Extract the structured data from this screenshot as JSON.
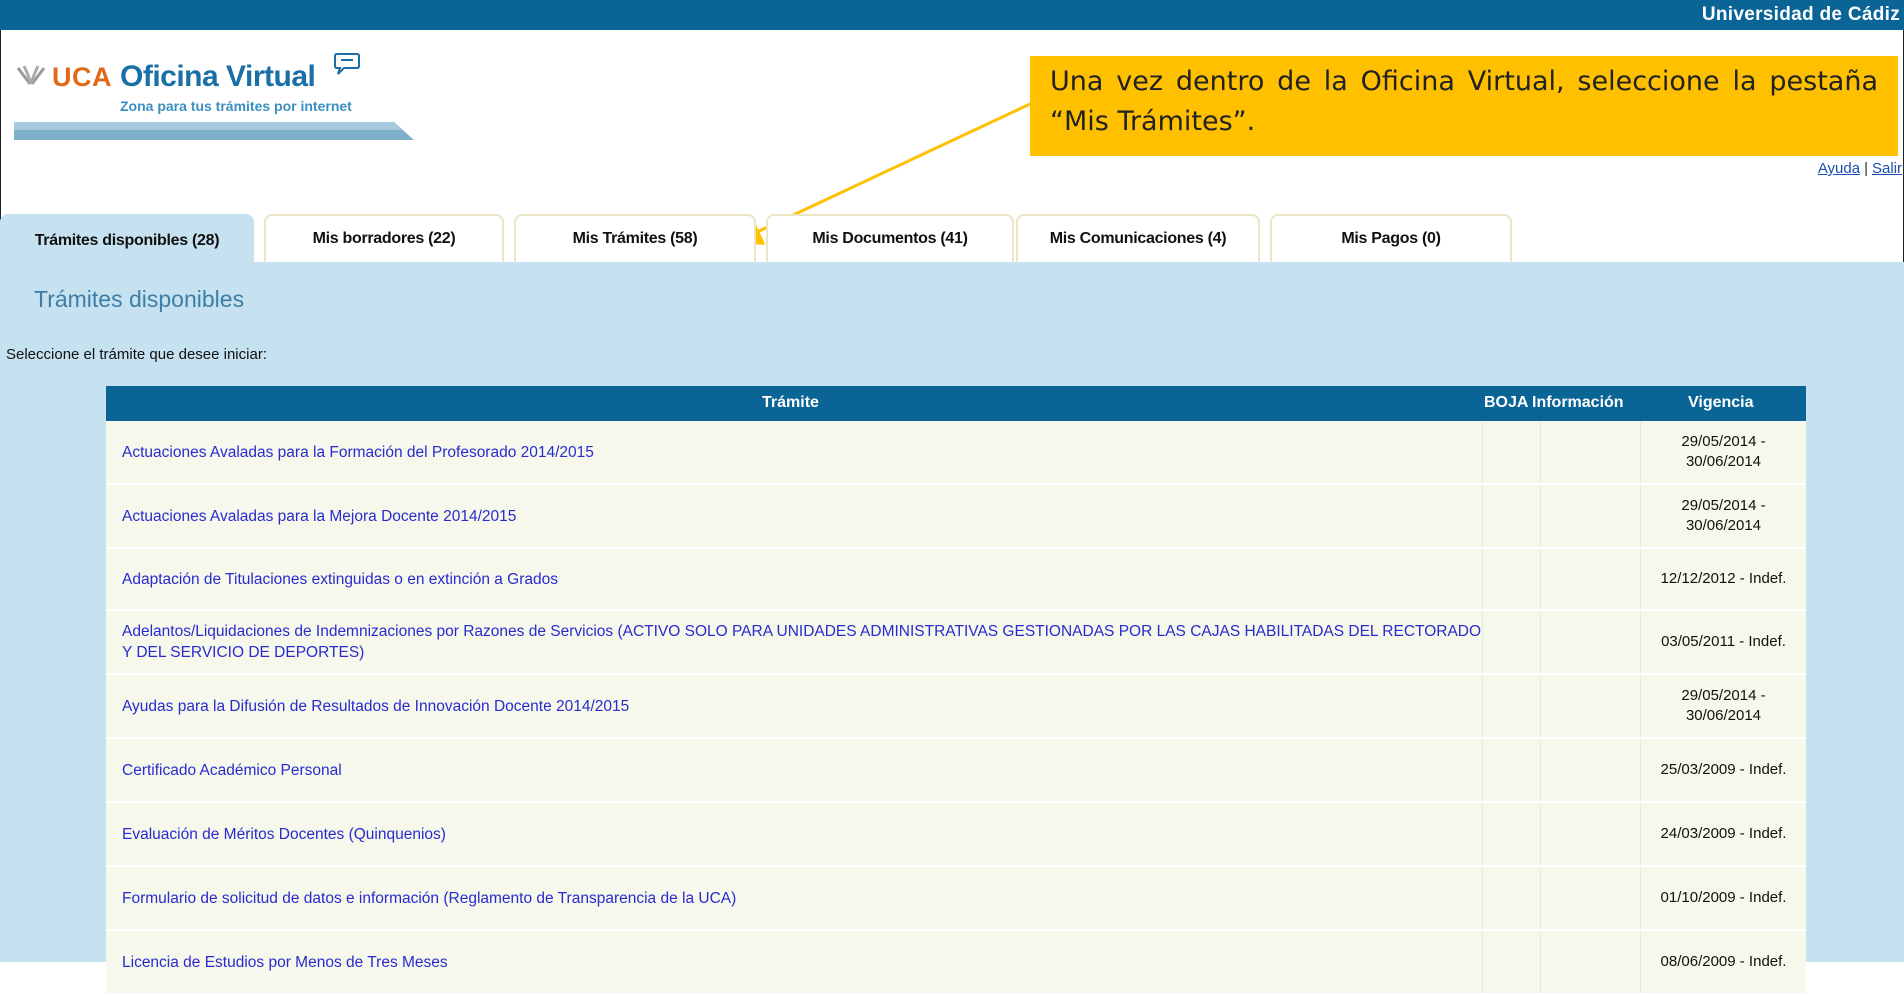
{
  "header": {
    "university": "Universidad de Cádiz",
    "logo": {
      "brand": "UCA",
      "title": "Oficina Virtual",
      "subtitle": "Zona para tus trámites por internet"
    },
    "links": {
      "help": "Ayuda",
      "separator": "|",
      "logout": "Salir"
    }
  },
  "callout": {
    "text": "Una vez dentro de la Oficina Virtual, seleccione la pestaña “Mis Trámites”."
  },
  "tabs": [
    {
      "label": "Trámites disponibles (28)",
      "active": true
    },
    {
      "label": "Mis borradores (22)",
      "active": false
    },
    {
      "label": "Mis Trámites (58)",
      "active": false
    },
    {
      "label": "Mis Documentos (41)",
      "active": false
    },
    {
      "label": "Mis Comunicaciones (4)",
      "active": false
    },
    {
      "label": "Mis Pagos (0)",
      "active": false
    }
  ],
  "main": {
    "title": "Trámites disponibles",
    "instructions": "Seleccione el trámite que desee iniciar:",
    "table": {
      "headers": {
        "tramite": "Trámite",
        "boja": "BOJA",
        "info": "Información",
        "vigencia": "Vigencia"
      },
      "rows": [
        {
          "name": "Actuaciones Avaladas para la Formación del Profesorado 2014/2015",
          "vigencia": "29/05/2014 - 30/06/2014"
        },
        {
          "name": "Actuaciones Avaladas para la Mejora Docente 2014/2015",
          "vigencia": "29/05/2014 - 30/06/2014"
        },
        {
          "name": "Adaptación de Titulaciones extinguidas o en extinción a Grados",
          "vigencia": "12/12/2012 - Indef."
        },
        {
          "name": "Adelantos/Liquidaciones de Indemnizaciones por Razones de Servicios (ACTIVO SOLO PARA UNIDADES ADMINISTRATIVAS GESTIONADAS POR LAS CAJAS HABILITADAS DEL RECTORADO Y DEL SERVICIO DE DEPORTES)",
          "vigencia": "03/05/2011 - Indef."
        },
        {
          "name": "Ayudas para la Difusión de Resultados de Innovación Docente 2014/2015",
          "vigencia": "29/05/2014 - 30/06/2014"
        },
        {
          "name": "Certificado Académico Personal",
          "vigencia": "25/03/2009 - Indef."
        },
        {
          "name": "Evaluación de Méritos Docentes (Quinquenios)",
          "vigencia": "24/03/2009 - Indef."
        },
        {
          "name": "Formulario de solicitud de datos e información (Reglamento de Transparencia de la UCA)",
          "vigencia": "01/10/2009 - Indef."
        },
        {
          "name": "Licencia de Estudios por Menos de Tres Meses",
          "vigencia": "08/06/2009 - Indef."
        }
      ]
    }
  },
  "colors": {
    "header_blue": "#0a6496",
    "panel_blue": "#c6e2f1",
    "callout_yellow": "#ffc000",
    "link_blue": "#2a2ad0"
  }
}
